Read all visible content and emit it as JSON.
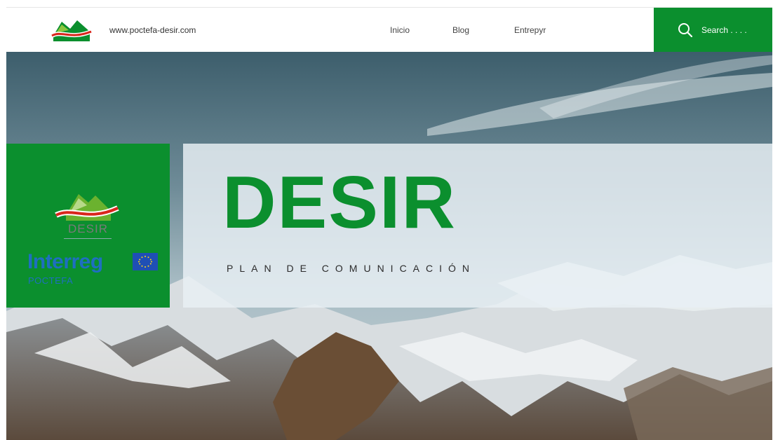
{
  "header": {
    "site_url": "www.poctefa-desir.com",
    "nav": [
      {
        "label": "Inicio"
      },
      {
        "label": "Blog"
      },
      {
        "label": "Entrepyr"
      }
    ],
    "search_label": "Search . . . ."
  },
  "hero": {
    "title": "DESIR",
    "subtitle": "PLAN DE COMUNICACIÓN",
    "panel": {
      "logo_text": "DESIR",
      "program_name": "Interreg",
      "program_sub": "POCTEFA"
    }
  },
  "colors": {
    "brand_green": "#0b8f2e",
    "interreg_blue": "#1e6fc0",
    "eu_blue": "#1f4fb5"
  }
}
